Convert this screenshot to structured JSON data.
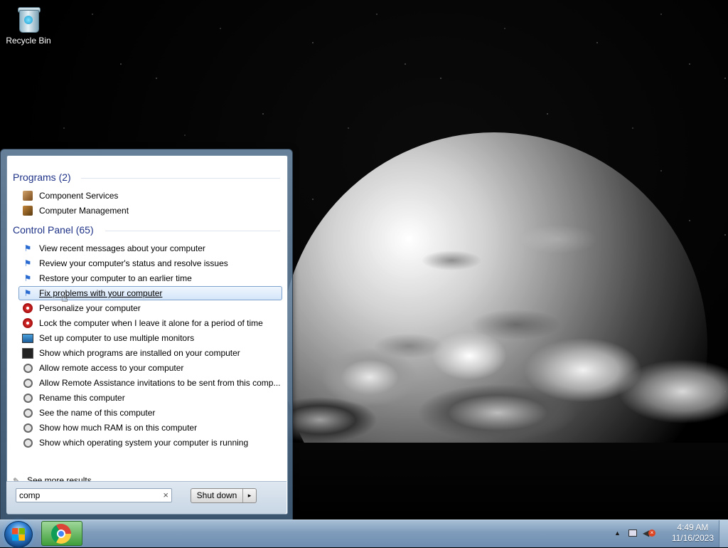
{
  "desktop": {
    "icons": [
      {
        "label": "Recycle Bin",
        "icon": "recycle-bin-icon"
      }
    ]
  },
  "start_menu": {
    "groups": [
      {
        "header": "Programs (2)",
        "items": [
          {
            "label": "Component Services",
            "icon": "component-services-icon"
          },
          {
            "label": "Computer Management",
            "icon": "computer-management-icon"
          }
        ]
      },
      {
        "header": "Control Panel (65)",
        "items": [
          {
            "label": "View recent messages about your computer",
            "icon": "action-center-flag-icon"
          },
          {
            "label": "Review your computer's status and resolve issues",
            "icon": "action-center-flag-icon"
          },
          {
            "label": "Restore your computer to an earlier time",
            "icon": "action-center-flag-icon"
          },
          {
            "label": "Fix problems with your computer",
            "icon": "action-center-flag-icon",
            "highlighted": true
          },
          {
            "label": "Personalize your computer",
            "icon": "personalization-icon"
          },
          {
            "label": "Lock the computer when I leave it alone for a period of time",
            "icon": "personalization-icon"
          },
          {
            "label": "Set up computer to use multiple monitors",
            "icon": "display-monitor-icon"
          },
          {
            "label": "Show which programs are installed on your computer",
            "icon": "programs-icon"
          },
          {
            "label": "Allow remote access to your computer",
            "icon": "system-icon"
          },
          {
            "label": "Allow Remote Assistance invitations to be sent from this comp...",
            "icon": "system-icon"
          },
          {
            "label": "Rename this computer",
            "icon": "system-icon"
          },
          {
            "label": "See the name of this computer",
            "icon": "system-icon"
          },
          {
            "label": "Show how much RAM is on this computer",
            "icon": "system-icon"
          },
          {
            "label": "Show which operating system your computer is running",
            "icon": "system-icon"
          }
        ]
      }
    ],
    "see_more": "See more results",
    "search": {
      "value": "comp",
      "clear_glyph": "×"
    },
    "shutdown": {
      "label": "Shut down",
      "arrow": "▸"
    }
  },
  "taskbar": {
    "pinned": [
      {
        "name": "Google Chrome",
        "icon": "chrome-icon",
        "active": true
      }
    ],
    "tray": {
      "overflow_glyph": "▲",
      "network_icon": "network-icon",
      "volume_icon": "volume-muted-icon"
    },
    "clock": {
      "time": "4:49 AM",
      "date": "11/16/2023"
    }
  },
  "colors": {
    "group_header": "#1e3287",
    "highlight_border": "#7da2ce",
    "taskbar": "#7f9cbb"
  }
}
